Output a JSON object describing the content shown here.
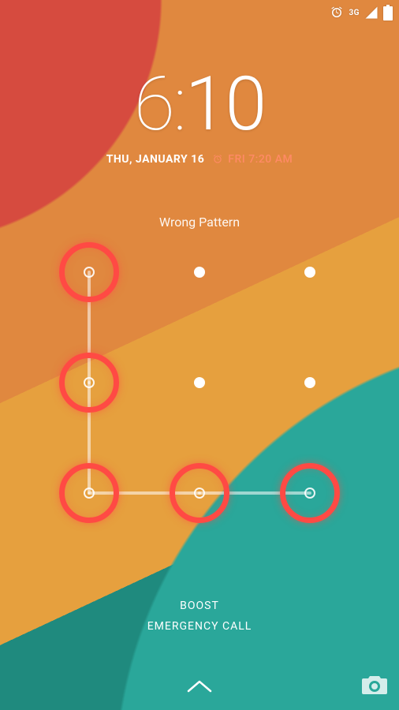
{
  "status_bar": {
    "network_label": "3G",
    "icons": [
      "alarm-icon",
      "network-3g-icon",
      "signal-icon",
      "battery-icon"
    ]
  },
  "clock": {
    "hour": "6",
    "separator": ":",
    "minute": "10",
    "date": "THU, JANUARY 16",
    "alarm": "FRI 7:20 AM"
  },
  "lock": {
    "status_message": "Wrong Pattern",
    "grid_size": 3,
    "error_path_indices": [
      0,
      3,
      6,
      7,
      8
    ]
  },
  "actions": {
    "boost": "BOOST",
    "emergency": "EMERGENCY CALL"
  },
  "colors": {
    "accent_error": "#ff4a44",
    "accent_alarm": "#ff8a65"
  }
}
